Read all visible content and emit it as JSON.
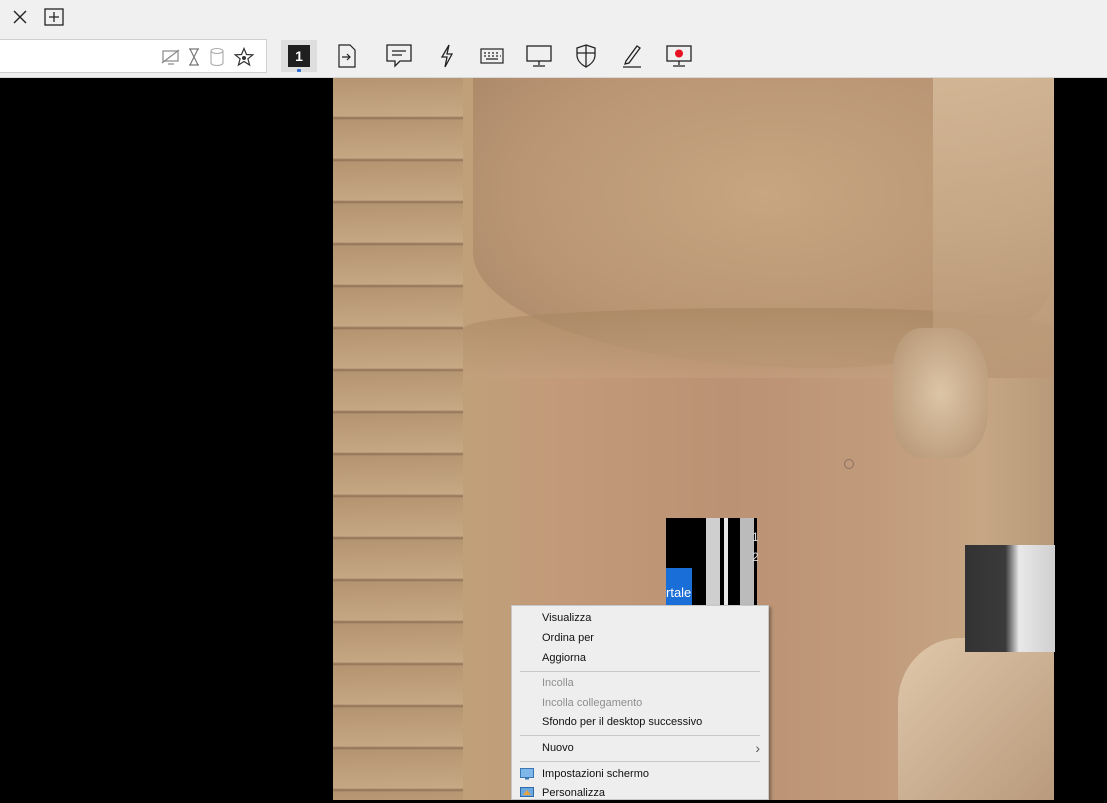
{
  "tabbar": {
    "close_icon": "close-icon",
    "new_tab_icon": "new-tab-icon"
  },
  "address_bar": {
    "icons": [
      "no-display-icon",
      "hourglass-icon",
      "database-icon",
      "star-icon"
    ]
  },
  "toolbar": {
    "monitor_number": "1",
    "icons": [
      "monitor-1",
      "file-transfer-icon",
      "chat-icon",
      "lightning-icon",
      "keyboard-icon",
      "display-icon",
      "shield-icon",
      "pencil-icon",
      "record-icon"
    ],
    "record_color": "#e81123",
    "active_indicator_color": "#2b6cd4"
  },
  "preview": {
    "text": "rtale",
    "digit_a": "1",
    "digit_b": "2"
  },
  "context_menu": {
    "items": [
      {
        "label": "Visualizza"
      },
      {
        "label": "Ordina per"
      },
      {
        "label": "Aggiorna"
      },
      {
        "label": "Incolla",
        "disabled": true
      },
      {
        "label": "Incolla collegamento",
        "disabled": true
      },
      {
        "label": "Sfondo per il desktop successivo"
      },
      {
        "label": "Nuovo",
        "submenu": true
      },
      {
        "label": "Impostazioni schermo",
        "icon": "display-settings-icon"
      },
      {
        "label": "Personalizza",
        "icon": "personalize-icon"
      }
    ]
  }
}
